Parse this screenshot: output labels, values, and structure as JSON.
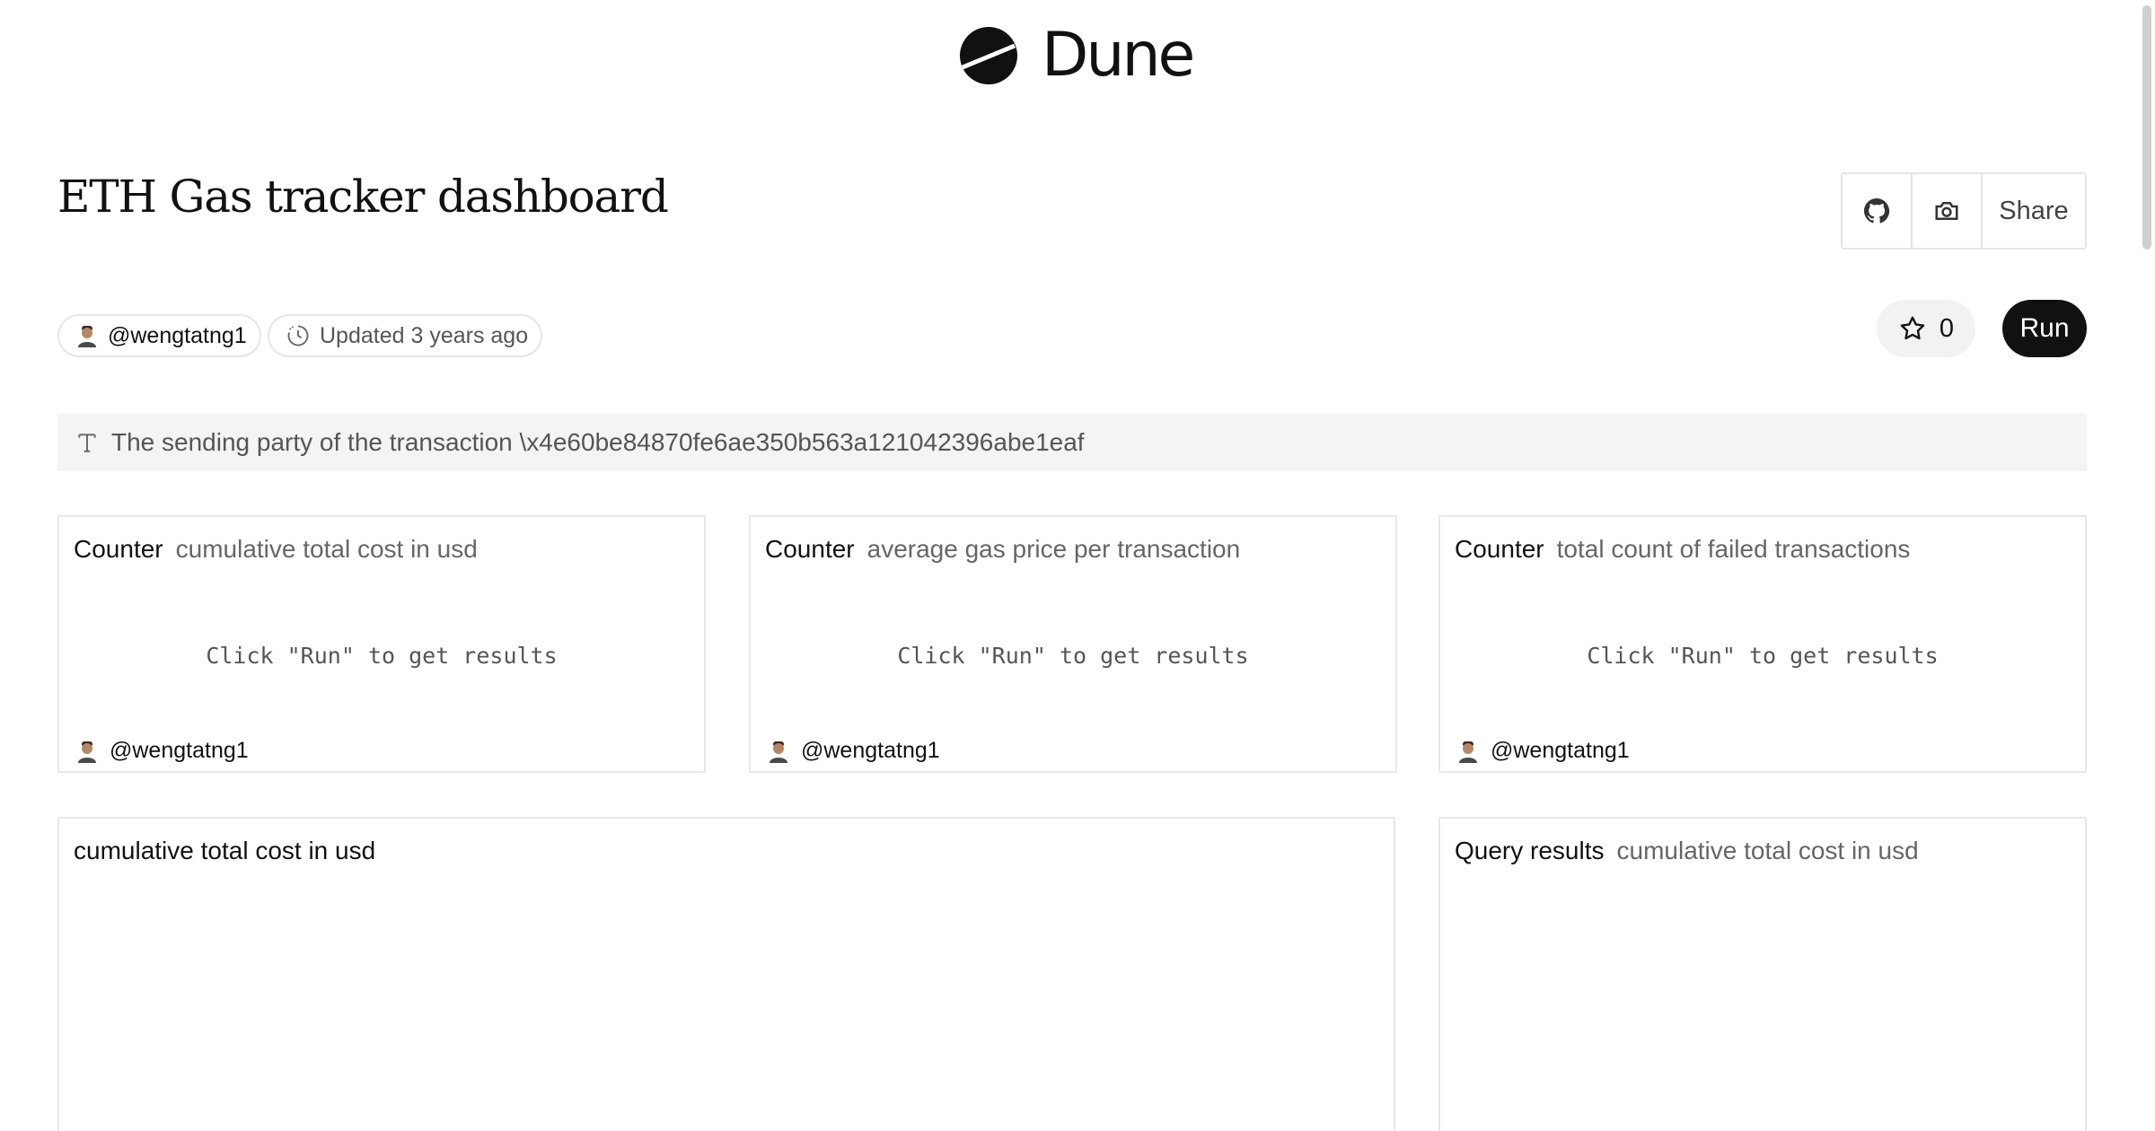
{
  "header": {
    "brand": "Dune"
  },
  "dashboard": {
    "title": "ETH Gas tracker dashboard"
  },
  "actions": {
    "share_label": "Share",
    "star_count": "0",
    "run_label": "Run"
  },
  "meta": {
    "author": "@wengtatng1",
    "updated_label": "Updated 3 years ago"
  },
  "param": {
    "text": "The sending party of the transaction \\x4e60be84870fe6ae350b563a121042396abe1eaf"
  },
  "cards": [
    {
      "type": "Counter",
      "subtitle": "cumulative total cost in usd",
      "message": "Click \"Run\" to get results",
      "author": "@wengtatng1"
    },
    {
      "type": "Counter",
      "subtitle": "average gas price per transaction",
      "message": "Click \"Run\" to get results",
      "author": "@wengtatng1"
    },
    {
      "type": "Counter",
      "subtitle": "total count of failed transactions",
      "message": "Click \"Run\" to get results",
      "author": "@wengtatng1"
    }
  ],
  "chart_card": {
    "title": "cumulative total cost in usd"
  },
  "query_card": {
    "type": "Query results",
    "subtitle": "cumulative total cost in usd"
  },
  "icons": {
    "logo": "dune-logo-icon",
    "github": "github-icon",
    "camera": "camera-icon",
    "star": "star-icon",
    "clock": "clock-icon",
    "text_param": "text-type-icon",
    "avatar": "avatar"
  },
  "colors": {
    "run_bg": "#111111",
    "param_bg": "#f4f4f4",
    "star_bg": "#f2f2f2"
  }
}
